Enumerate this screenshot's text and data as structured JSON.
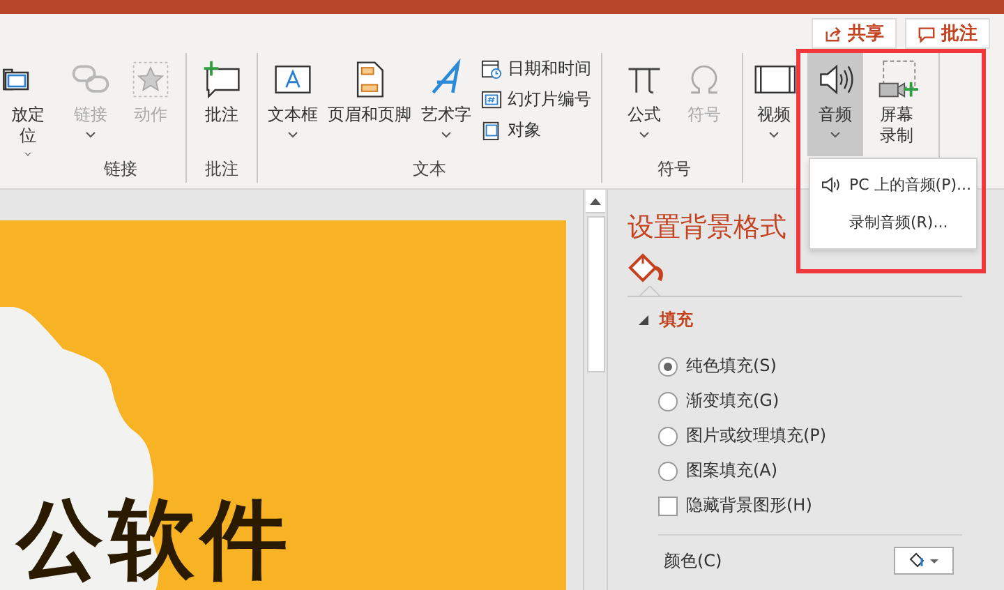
{
  "top_buttons": [
    {
      "label": "共享",
      "kind": "share"
    },
    {
      "label": "批注",
      "kind": "comment"
    }
  ],
  "ribbon": {
    "groups": [
      {
        "items": [
          {
            "kind": "large",
            "lines": [
              "放定",
              "位"
            ],
            "dropdown": true,
            "disabled": false,
            "selected": false
          }
        ]
      },
      {
        "label": "链接",
        "items": [
          {
            "kind": "large",
            "lines": [
              "链接"
            ],
            "dropdown": true,
            "disabled": true,
            "selected": false
          },
          {
            "kind": "large",
            "lines": [
              "动作"
            ],
            "dropdown": false,
            "disabled": true,
            "selected": false
          }
        ]
      },
      {
        "label": "批注",
        "items": [
          {
            "kind": "large",
            "lines": [
              "批注"
            ],
            "dropdown": false,
            "disabled": false,
            "selected": false
          }
        ]
      },
      {
        "label": "文本",
        "items": [
          {
            "kind": "large",
            "lines": [
              "文本框"
            ],
            "dropdown": true,
            "disabled": false,
            "selected": false
          },
          {
            "kind": "large",
            "lines": [
              "页眉和页脚"
            ],
            "dropdown": false,
            "disabled": false,
            "selected": false
          },
          {
            "kind": "large",
            "lines": [
              "艺术字"
            ],
            "dropdown": true,
            "disabled": false,
            "selected": false
          },
          {
            "kind": "small",
            "entries": [
              {
                "label": "日期和时间"
              },
              {
                "label": "幻灯片编号"
              },
              {
                "label": "对象"
              }
            ]
          }
        ]
      },
      {
        "label": "符号",
        "items": [
          {
            "kind": "large",
            "lines": [
              "公式"
            ],
            "dropdown": true,
            "disabled": false,
            "selected": false
          },
          {
            "kind": "large",
            "lines": [
              "符号"
            ],
            "dropdown": false,
            "disabled": true,
            "selected": false
          }
        ]
      },
      {
        "items": [
          {
            "kind": "large",
            "lines": [
              "视频"
            ],
            "dropdown": true,
            "disabled": false,
            "selected": false
          },
          {
            "kind": "large",
            "lines": [
              "音频"
            ],
            "dropdown": true,
            "disabled": false,
            "selected": true
          },
          {
            "kind": "large",
            "lines": [
              "屏幕",
              "录制"
            ],
            "dropdown": false,
            "disabled": false,
            "selected": false
          }
        ]
      }
    ]
  },
  "audio_menu": {
    "items": [
      {
        "label": "PC 上的音频(P)...",
        "icon": true
      },
      {
        "label": "录制音频(R)...",
        "icon": false
      }
    ]
  },
  "highlight_box": true,
  "slide": {
    "title": "公软件"
  },
  "format_pane": {
    "title": "设置背景格式",
    "section": {
      "label": "填充",
      "expanded": true
    },
    "options": [
      {
        "kind": "radio",
        "label": "纯色填充(S)",
        "selected": true
      },
      {
        "kind": "radio",
        "label": "渐变填充(G)",
        "selected": false
      },
      {
        "kind": "radio",
        "label": "图片或纹理填充(P)",
        "selected": false
      },
      {
        "kind": "radio",
        "label": "图案填充(A)",
        "selected": false
      },
      {
        "kind": "checkbox",
        "label": "隐藏背景图形(H)",
        "checked": false
      }
    ],
    "color_label": "颜色(C)"
  }
}
